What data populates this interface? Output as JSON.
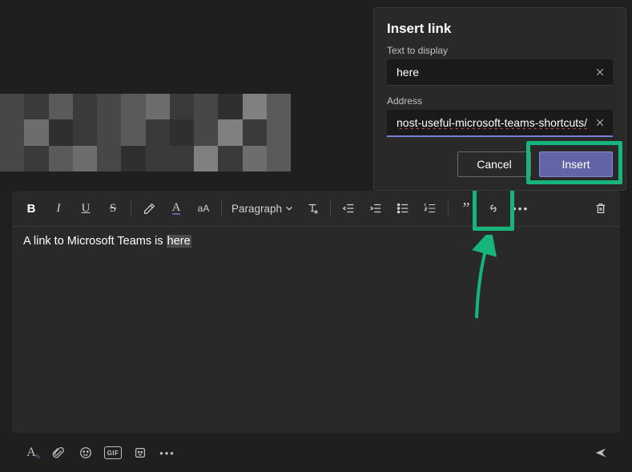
{
  "dialog": {
    "title": "Insert link",
    "text_label": "Text to display",
    "text_value": "here",
    "address_label": "Address",
    "address_value": "nost-useful-microsoft-teams-shortcuts/",
    "cancel": "Cancel",
    "insert": "Insert"
  },
  "toolbar": {
    "bold": "B",
    "italic": "I",
    "underline": "U",
    "strike": "S",
    "font_color": "A",
    "font_size_glyph": "aA",
    "paragraph_label": "Paragraph",
    "quote": "”",
    "more": "•••"
  },
  "editor": {
    "content_prefix": "A link to Microsoft Teams is ",
    "content_selected": "here"
  },
  "bottom": {
    "gif": "GIF",
    "more": "•••"
  }
}
